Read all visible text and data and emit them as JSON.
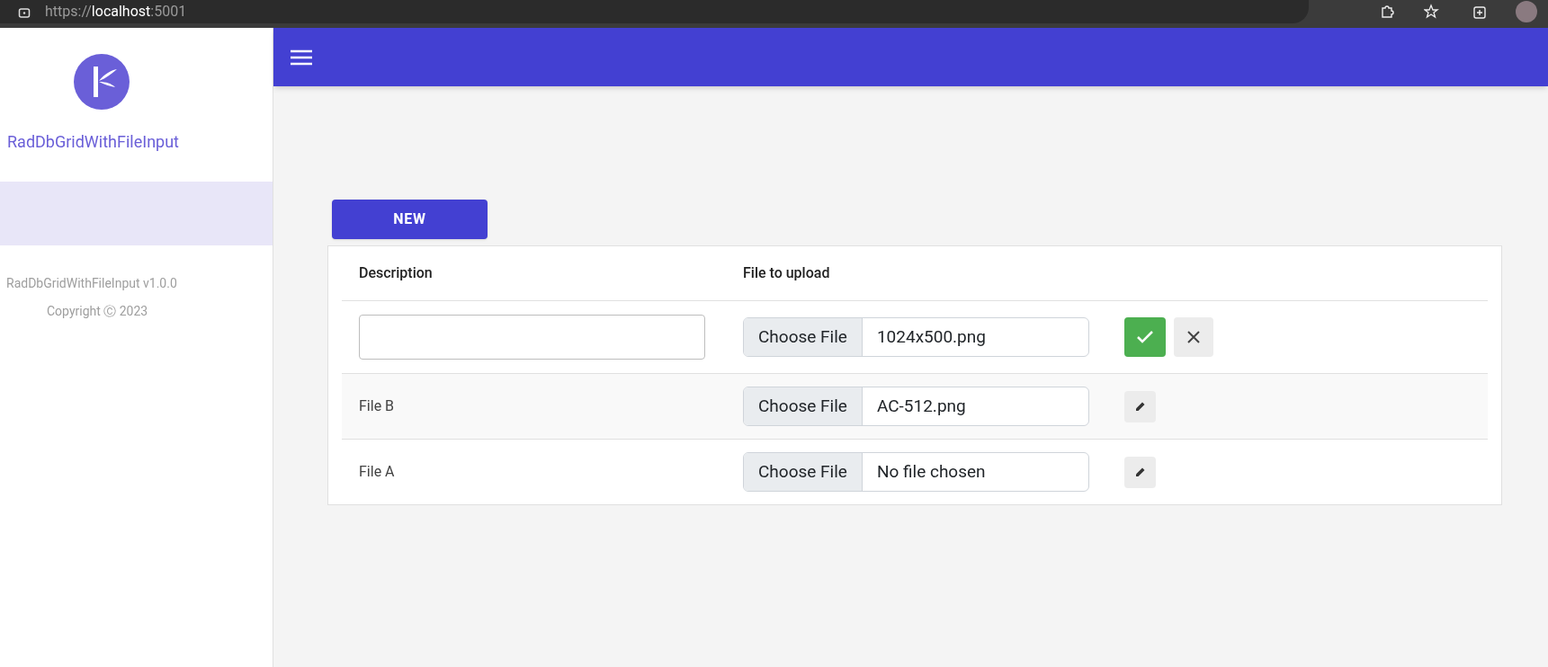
{
  "browser": {
    "url": "https://**localhost**:5001"
  },
  "sidebar": {
    "app_name": "RadDbGridWithFileInput",
    "items": [
      {
        "selected": true
      }
    ],
    "footer": [
      "RadDbGridWithFileInput v1.0.0",
      "Copyright Ⓒ 2023"
    ]
  },
  "toolbar": {
    "new_button": "NEW"
  },
  "table": {
    "columns": [
      "Description",
      "File to upload"
    ],
    "rows": [
      {
        "kind": "edit",
        "description": "",
        "file_button": "Choose File",
        "file_name": "1024x500.png"
      },
      {
        "kind": "view",
        "description": "File B",
        "file_button": "Choose File",
        "file_name": "AC-512.png"
      },
      {
        "kind": "view",
        "description": "File A",
        "file_button": "Choose File",
        "file_name": "No file chosen"
      }
    ]
  }
}
